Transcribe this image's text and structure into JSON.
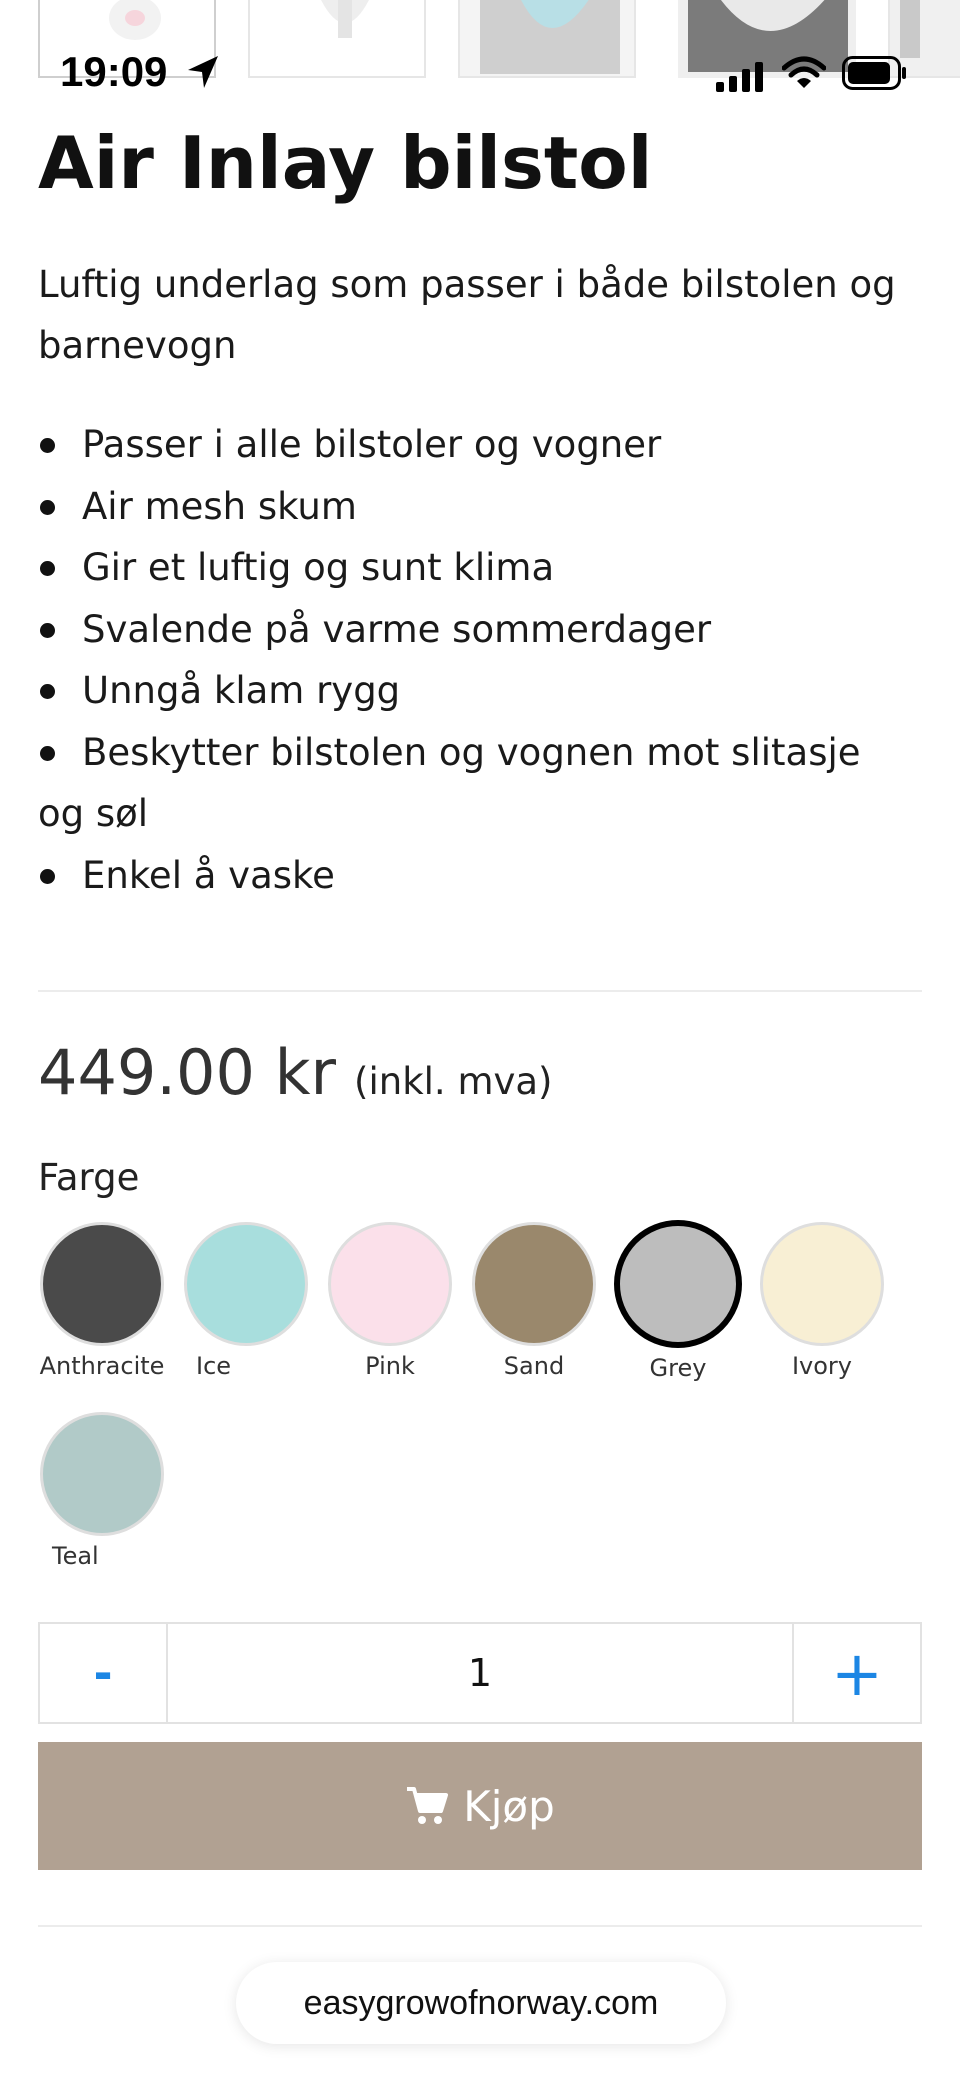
{
  "status_bar": {
    "time": "19:09"
  },
  "product": {
    "title": "Air Inlay bilstol",
    "lead": "Luftig underlag som passer i både bilstolen og barnevogn",
    "features": [
      "Passer i alle bilstoler og vogner",
      "Air mesh skum",
      "Gir et luftig og sunt klima",
      "Svalende på varme sommerdager",
      "Unngå klam rygg",
      "Beskytter bilstolen og vognen mot slitasje og søl",
      "Enkel å vaske"
    ],
    "price": "449.00 kr",
    "vat_note": "(inkl. mva)"
  },
  "colors": {
    "label": "Farge",
    "selected": "Grey",
    "options": [
      {
        "name": "Anthracite",
        "hex": "#4a4a4a"
      },
      {
        "name": "Ice",
        "hex": "#a8dedd"
      },
      {
        "name": "Pink",
        "hex": "#fbe0ea"
      },
      {
        "name": "Sand",
        "hex": "#9a886c"
      },
      {
        "name": "Grey",
        "hex": "#bdbdbd"
      },
      {
        "name": "Ivory",
        "hex": "#f8efd4"
      },
      {
        "name": "Teal",
        "hex": "#b1cac8"
      }
    ]
  },
  "quantity": {
    "minus": "-",
    "value": "1",
    "plus": "+"
  },
  "buy_button": {
    "label": "Kjøp",
    "color": "#b1a192"
  },
  "accent_color": "#1c86e4",
  "browser": {
    "url": "easygrowofnorway.com"
  }
}
